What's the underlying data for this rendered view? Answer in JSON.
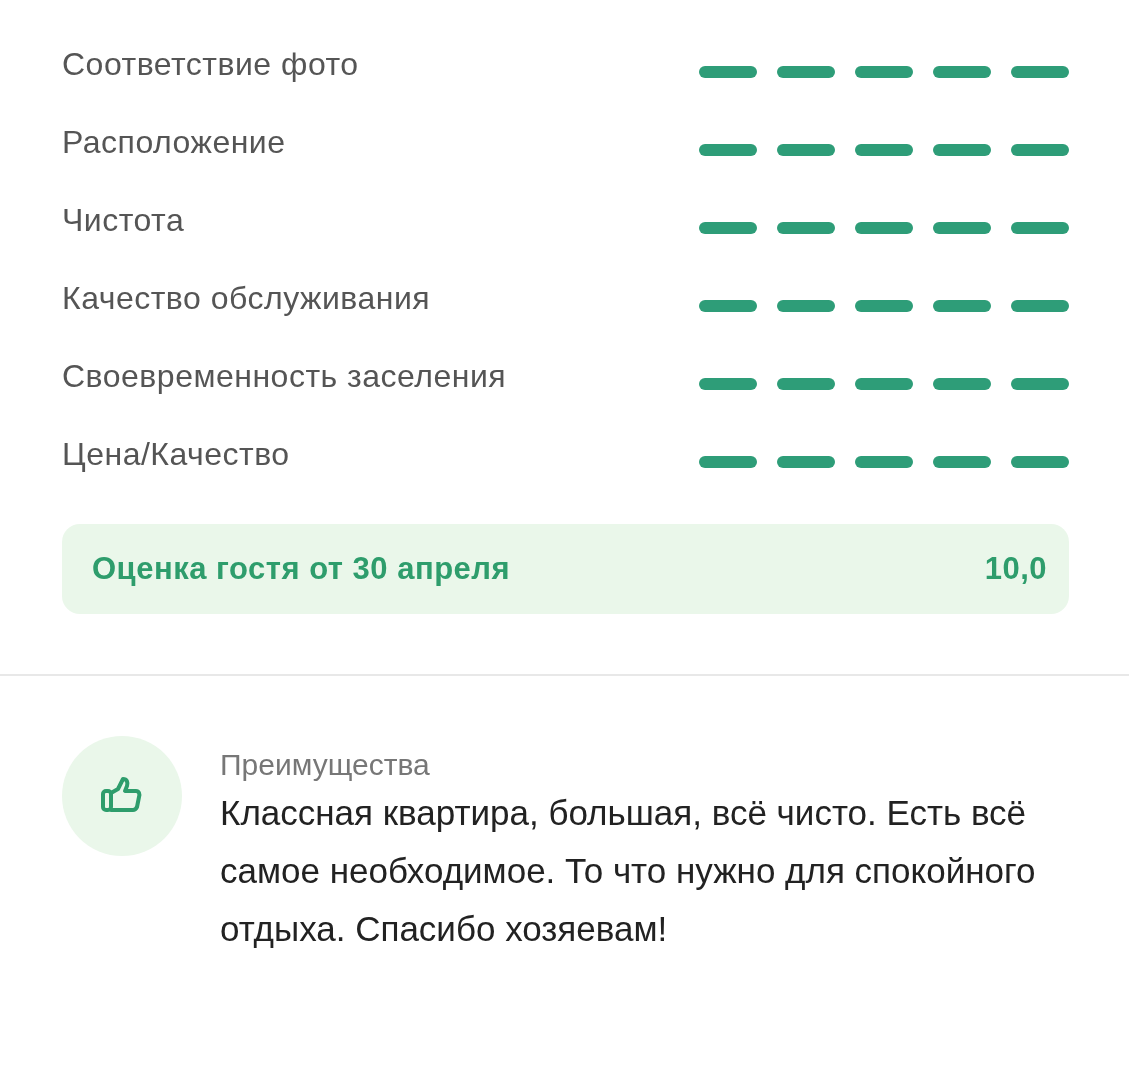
{
  "ratings": [
    {
      "label": "Соответствие фото",
      "stars": 5
    },
    {
      "label": "Расположение",
      "stars": 5
    },
    {
      "label": "Чистота",
      "stars": 5
    },
    {
      "label": "Качество обслуживания",
      "stars": 5
    },
    {
      "label": "Своевременность заселения",
      "stars": 5
    },
    {
      "label": "Цена/Качество",
      "stars": 5
    }
  ],
  "score": {
    "label": "Оценка гостя от 30 апреля",
    "value": "10,0"
  },
  "review": {
    "heading": "Преимущества",
    "text": "Классная квартира, большая, всё чисто. Есть всё самое необходимое. То что нужно для спокойного отдыха. Спасибо хозяевам!"
  }
}
